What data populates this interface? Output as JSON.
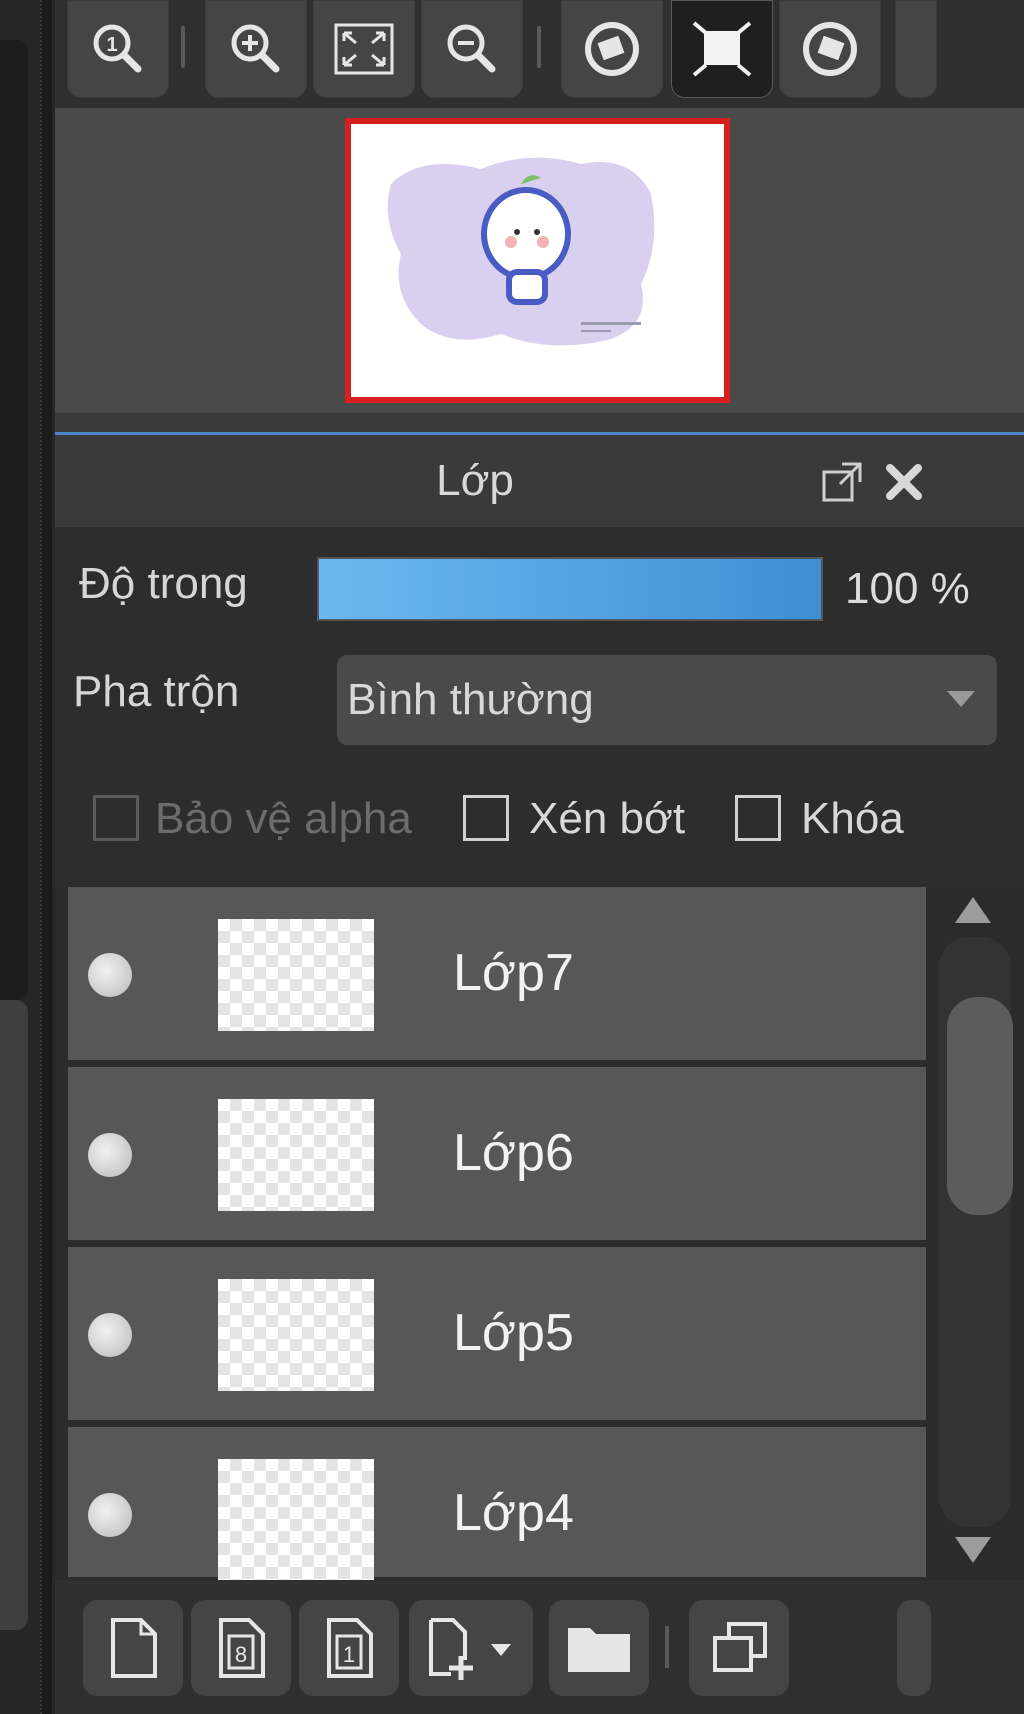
{
  "toolbar": {
    "buttons": [
      {
        "name": "zoom-actual-size-icon"
      },
      {
        "name": "zoom-in-icon"
      },
      {
        "name": "fit-window-icon"
      },
      {
        "name": "zoom-out-icon"
      },
      {
        "name": "rotate-left-icon"
      },
      {
        "name": "fullscreen-icon"
      },
      {
        "name": "rotate-right-icon"
      }
    ]
  },
  "navigator": {
    "frame_color": "#d71f1f"
  },
  "panel": {
    "title": "Lớp"
  },
  "properties": {
    "opacity_label": "Độ trong",
    "opacity_value_text": "100 %",
    "opacity_level": 1.0,
    "blend_label": "Pha trộn",
    "blend_value": "Bình thường",
    "checkboxes": [
      {
        "label": "Bảo vệ alpha",
        "checked": false,
        "enabled": false
      },
      {
        "label": "Xén bớt",
        "checked": false,
        "enabled": true
      },
      {
        "label": "Khóa",
        "checked": false,
        "enabled": true
      }
    ]
  },
  "layers": [
    {
      "name": "Lớp7"
    },
    {
      "name": "Lớp6"
    },
    {
      "name": "Lớp5"
    },
    {
      "name": "Lớp4"
    }
  ],
  "bottom_toolbar": {
    "buttons": [
      {
        "name": "new-layer-icon"
      },
      {
        "name": "new-8bit-layer-icon"
      },
      {
        "name": "new-1bit-layer-icon"
      },
      {
        "name": "add-layer-dropdown-icon"
      },
      {
        "name": "new-folder-icon"
      },
      {
        "name": "duplicate-layer-icon"
      }
    ]
  },
  "colors": {
    "accent": "#4a86c5",
    "opacity_fill": "#5aa6e4",
    "panel_bg": "#2d2d2d",
    "layer_row_bg": "#575757"
  }
}
